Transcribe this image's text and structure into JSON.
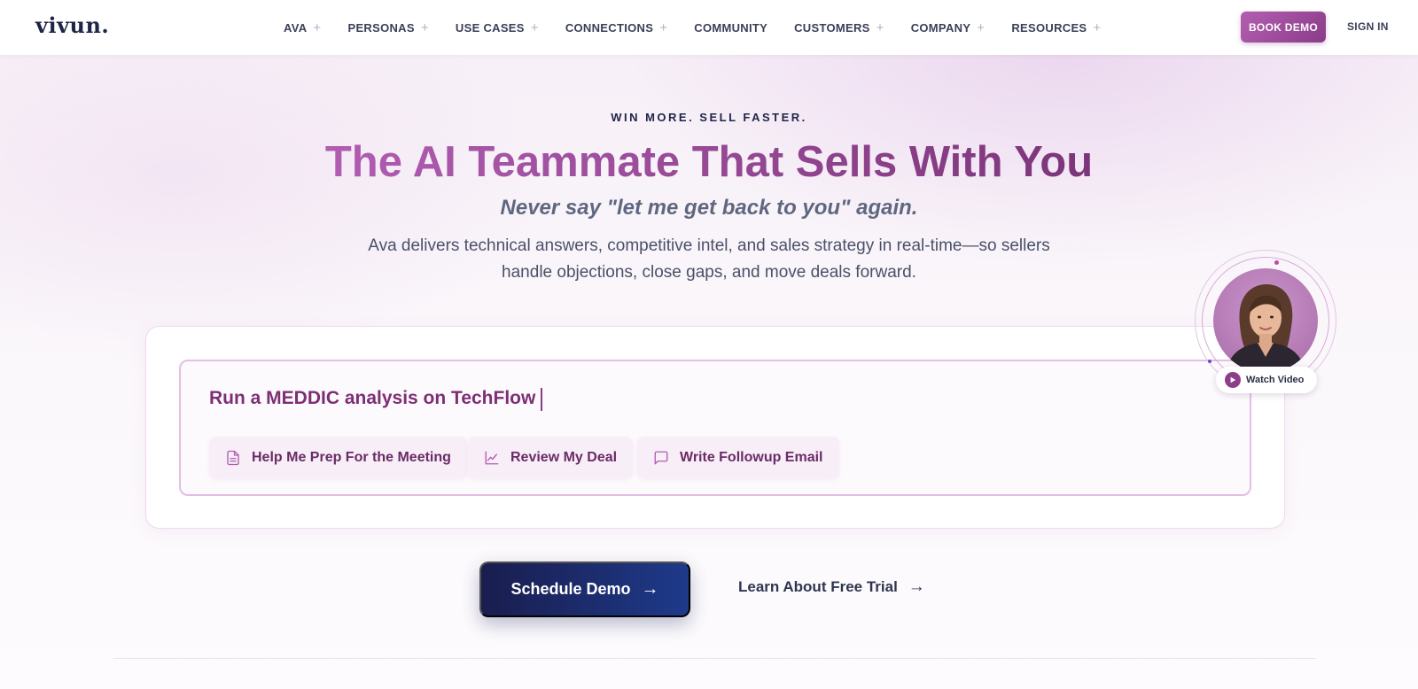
{
  "brand": {
    "logo": "vivun."
  },
  "nav": {
    "items": [
      {
        "label": "AVA",
        "expand": "+"
      },
      {
        "label": "PERSONAS",
        "expand": "+"
      },
      {
        "label": "USE CASES",
        "expand": "+"
      },
      {
        "label": "CONNECTIONS",
        "expand": "+"
      },
      {
        "label": "COMMUNITY",
        "expand": ""
      },
      {
        "label": "CUSTOMERS",
        "expand": "+"
      },
      {
        "label": "COMPANY",
        "expand": "+"
      },
      {
        "label": "RESOURCES",
        "expand": "+"
      }
    ],
    "book_demo": "BOOK DEMO",
    "sign_in": "SIGN IN"
  },
  "hero": {
    "eyebrow": "WIN MORE. SELL FASTER.",
    "headline": "The AI Teammate That Sells With You",
    "subhead": "Never say \"let me get back to you\" again.",
    "description": "Ava delivers technical answers, competitive intel, and sales strategy in real-time—so sellers handle objections, close gaps, and move deals forward."
  },
  "prompt": {
    "text": "Run a MEDDIC analysis on TechFlow",
    "chips": [
      {
        "label": "Help Me Prep For the Meeting",
        "icon": "document-icon"
      },
      {
        "label": "Review My Deal",
        "icon": "chart-line-icon"
      },
      {
        "label": "Write Followup Email",
        "icon": "chat-bubble-icon"
      }
    ]
  },
  "video": {
    "label": "Watch Video"
  },
  "cta": {
    "schedule_demo": "Schedule Demo",
    "free_trial": "Learn About Free Trial"
  },
  "colors": {
    "accent": "#9b4a98",
    "navy": "#1a1d4e",
    "text": "#2b2f45"
  }
}
